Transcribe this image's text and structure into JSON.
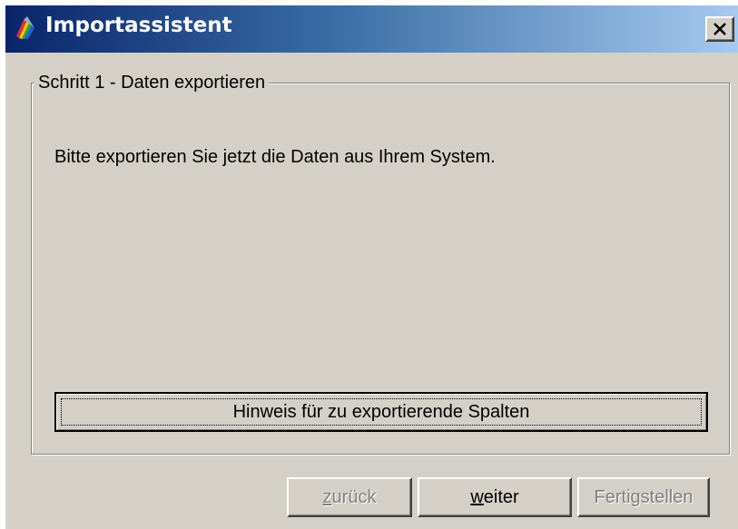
{
  "window": {
    "title": "Importassistent",
    "close_glyph": "✕",
    "app_icon": "wizard-app-icon"
  },
  "step_group": {
    "legend": "Schritt 1 - Daten exportieren",
    "instruction": "Bitte exportieren Sie jetzt die Daten aus Ihrem System.",
    "hint_button_label": "Hinweis für zu exportierende Spalten"
  },
  "footer": {
    "back": {
      "mnemonic": "z",
      "rest": "urück",
      "enabled": false
    },
    "next": {
      "mnemonic": "w",
      "rest": "eiter",
      "enabled": true
    },
    "finish": {
      "label": "Fertigstellen",
      "enabled": false
    }
  },
  "colors": {
    "face": "#d4d0c8",
    "title_gradient_start": "#0a246a",
    "title_gradient_end": "#a6caf0",
    "disabled_text": "#808080"
  }
}
